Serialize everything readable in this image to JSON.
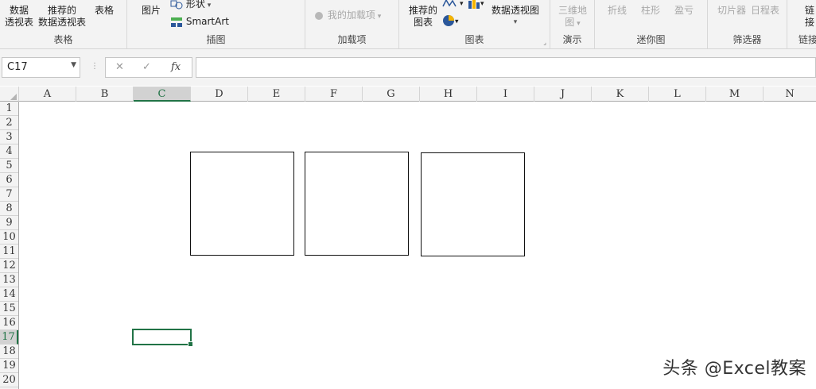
{
  "ribbon": {
    "groups": [
      {
        "label": "表格",
        "buttons": [
          "数据\n透视表",
          "推荐的\n数据透视表",
          "表格"
        ]
      },
      {
        "label": "插图",
        "buttons": [
          "图片",
          "形状",
          "SmartArt"
        ]
      },
      {
        "label": "加载项",
        "buttons": [
          "我的加载项"
        ]
      },
      {
        "label": "图表",
        "buttons": [
          "推荐的\n图表",
          "数据透视图"
        ]
      },
      {
        "label": "演示",
        "buttons": [
          "三维地\n图"
        ]
      },
      {
        "label": "迷你图",
        "buttons": [
          "折线",
          "柱形",
          "盈亏"
        ]
      },
      {
        "label": "筛选器",
        "buttons": [
          "切片器",
          "日程表"
        ]
      },
      {
        "label": "链接",
        "buttons": [
          "链\n接"
        ]
      }
    ]
  },
  "formula_bar": {
    "name_box": "C17",
    "cancel_glyph": "✕",
    "enter_glyph": "✓",
    "fx_glyph": "fx",
    "formula_value": ""
  },
  "columns": [
    "A",
    "B",
    "C",
    "D",
    "E",
    "F",
    "G",
    "H",
    "I",
    "J",
    "K",
    "L",
    "M",
    "N"
  ],
  "selected_column": "C",
  "rows": [
    "1",
    "2",
    "3",
    "4",
    "5",
    "6",
    "7",
    "8",
    "9",
    "10",
    "11",
    "12",
    "13",
    "14",
    "15",
    "16",
    "17",
    "18",
    "19",
    "20"
  ],
  "selected_row": "17",
  "watermark": "头条 @Excel教案"
}
